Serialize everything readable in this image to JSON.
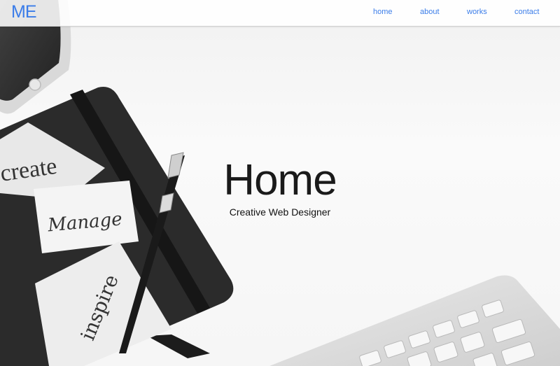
{
  "nav": {
    "brand": "ME",
    "links": [
      {
        "label": "home"
      },
      {
        "label": "about"
      },
      {
        "label": "works"
      },
      {
        "label": "contact"
      }
    ]
  },
  "hero": {
    "title": "Home",
    "subtitle": "Creative Web Designer",
    "cards": [
      "create",
      "Manage",
      "inspire"
    ]
  },
  "colors": {
    "accent": "#3b7de9",
    "text": "#1a1a1a"
  }
}
